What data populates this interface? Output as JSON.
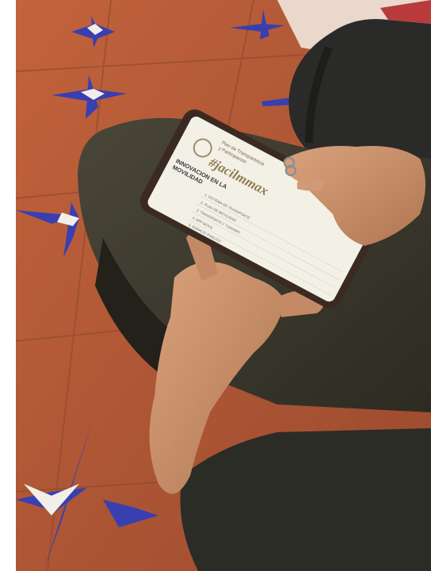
{
  "photo": {
    "kind": "photograph",
    "screen": {
      "title_line1": "Plan de Transparencia",
      "title_line2": "y Participacion",
      "hashtag": "#jacilmmax",
      "heading_line1": "INNOVACION EN LA",
      "heading_line2": "MOVILIDAD",
      "list_items": [
        "1. SISTEMA DE TRANSPORTE",
        "2. PLAN DE MOVILIDAD",
        "3. TRANSPORTE Y TURISMO",
        "4. APP MOVIL",
        "5. ESPACIO PUBLICO"
      ]
    },
    "colors": {
      "floor_tile": "#b45a37",
      "tile_accent": "#3a3fb0",
      "tile_white": "#f2efe8",
      "sleeve": "#2b2c26",
      "pants": "#3c3a30",
      "skin": "#c98f6b",
      "phone": "#3b2a22",
      "screen": "#f3f0e6"
    }
  }
}
